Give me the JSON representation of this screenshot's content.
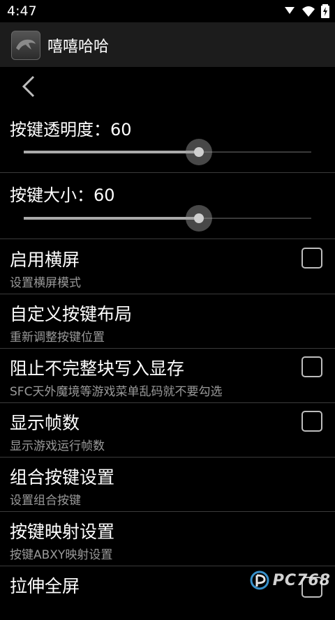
{
  "status_bar": {
    "time": "4:47"
  },
  "app_bar": {
    "title": "嘻嘻哈哈"
  },
  "sliders": [
    {
      "label": "按键透明度：60",
      "value": 60
    },
    {
      "label": "按键大小：60",
      "value": 60
    }
  ],
  "prefs": [
    {
      "title": "启用横屏",
      "summary": "设置横屏模式",
      "checkbox": true
    },
    {
      "title": "自定义按键布局",
      "summary": "重新调整按键位置",
      "checkbox": false
    },
    {
      "title": "阻止不完整块写入显存",
      "summary": "SFC天外魔境等游戏菜单乱码就不要勾选",
      "checkbox": true
    },
    {
      "title": "显示帧数",
      "summary": "显示游戏运行帧数",
      "checkbox": true
    },
    {
      "title": "组合按键设置",
      "summary": "设置组合按键",
      "checkbox": false
    },
    {
      "title": "按键映射设置",
      "summary": "按键ABXY映射设置",
      "checkbox": false
    },
    {
      "title": "拉伸全屏",
      "summary": "",
      "checkbox": true
    }
  ],
  "watermark": {
    "text": "PC768"
  }
}
